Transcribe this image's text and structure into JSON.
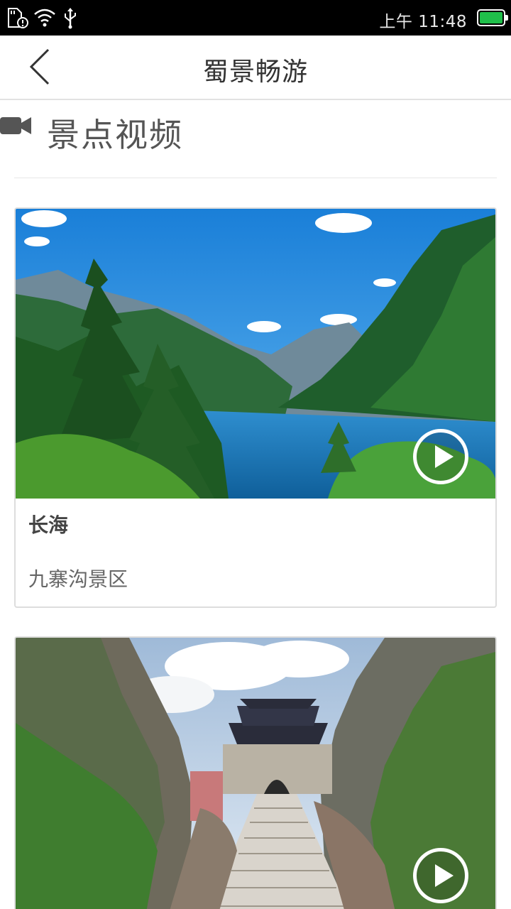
{
  "status_bar": {
    "time": "上午 11:48",
    "icons": [
      "sd-card-alert-icon",
      "wifi-icon",
      "usb-icon",
      "battery-icon"
    ],
    "battery_color": "#1fbf4a"
  },
  "header": {
    "back_icon": "chevron-left-icon",
    "title": "蜀景畅游"
  },
  "section": {
    "icon": "video-camera-icon",
    "title": "景点视频"
  },
  "videos": [
    {
      "title": "长海",
      "area": "九寨沟景区",
      "play_icon": "play-circle-icon"
    },
    {
      "title": "",
      "area": "",
      "play_icon": "play-circle-icon"
    }
  ]
}
